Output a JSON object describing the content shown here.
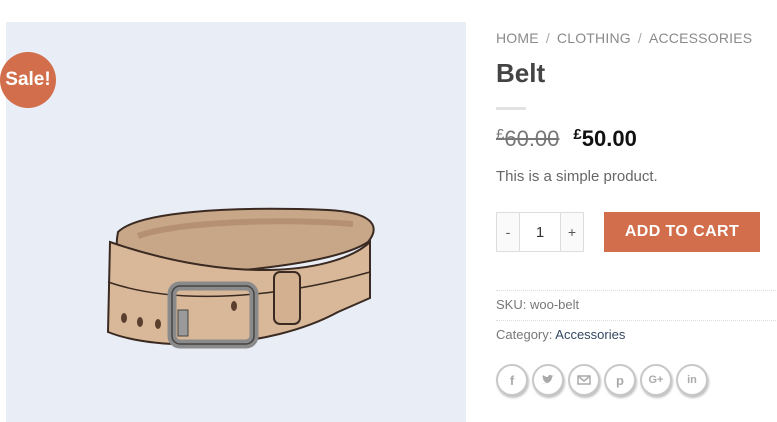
{
  "gallery": {
    "sale_badge": "Sale!"
  },
  "breadcrumb": {
    "items": [
      "HOME",
      "CLOTHING",
      "ACCESSORIES"
    ],
    "separator": "/"
  },
  "product": {
    "title": "Belt",
    "old_price_symbol": "£",
    "old_price": "60.00",
    "new_price_symbol": "£",
    "new_price": "50.00",
    "short_description": "This is a simple product."
  },
  "cart": {
    "minus": "-",
    "quantity": "1",
    "plus": "+",
    "add_to_cart": "ADD TO CART"
  },
  "meta": {
    "sku_label": "SKU:",
    "sku_value": "woo-belt",
    "category_label": "Category:",
    "category_value": "Accessories"
  },
  "share_icons": [
    "facebook-icon",
    "twitter-icon",
    "email-icon",
    "pinterest-icon",
    "google-plus-icon",
    "linkedin-icon"
  ],
  "colors": {
    "accent": "#d26e4b",
    "gallery_bg": "#e9eef6",
    "link": "#334862"
  }
}
